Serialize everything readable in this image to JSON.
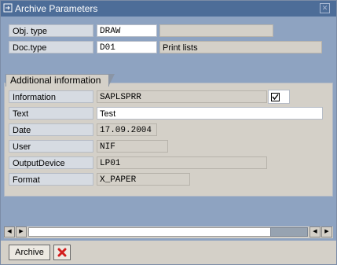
{
  "window": {
    "title": "Archive Parameters"
  },
  "header_fields": [
    {
      "label": "Obj. type",
      "value": "DRAW",
      "extra": ""
    },
    {
      "label": "Doc.type",
      "value": "D01",
      "extra": "Print lists"
    }
  ],
  "group": {
    "title": "Additional information",
    "fields": [
      {
        "label": "Information",
        "value": "SAPLSPRR",
        "checked": true
      },
      {
        "label": "Text",
        "value": "Test"
      },
      {
        "label": "Date",
        "value": "17.09.2004"
      },
      {
        "label": "User",
        "value": "NIF"
      },
      {
        "label": "OutputDevice",
        "value": "LP01"
      },
      {
        "label": "Format",
        "value": "X_PAPER"
      }
    ]
  },
  "toolbar": {
    "archive_label": "Archive"
  },
  "icons": {
    "title": "window-icon",
    "close": "close-icon",
    "checkbox": "checkbox-icon",
    "cancel": "cancel-icon"
  }
}
